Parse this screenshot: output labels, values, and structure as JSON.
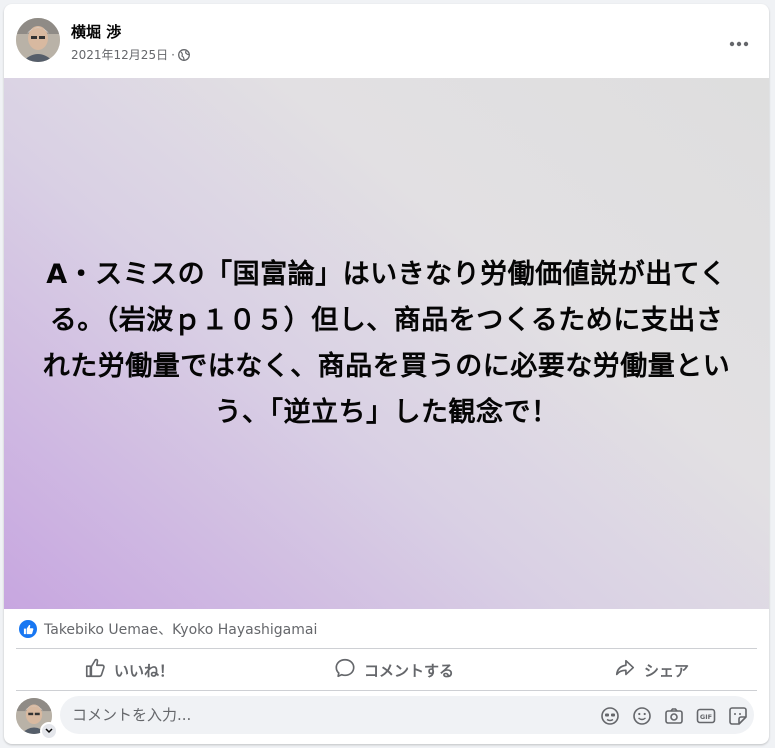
{
  "post": {
    "author": "横堀 渉",
    "date": "2021年12月25日",
    "separator": "·",
    "privacy_icon": "globe-icon",
    "more_icon": "more-options-icon",
    "banner_text": "A・スミスの「国富論」はいきなり労働価値説が出てくる。（岩波ｐ１０５）但し、商品をつくるために支出された労働量ではなく、商品を買うのに必要な労働量という、「逆立ち」した観念で！",
    "banner_colors": {
      "start": "#c7a6e0",
      "end": "#dedede"
    }
  },
  "reactions": {
    "icon": "like-badge-icon",
    "names": "Takebiko Uemae、Kyoko Hayashigamai"
  },
  "actions": {
    "like_label": "いいね！",
    "comment_label": "コメントする",
    "share_label": "シェア"
  },
  "comment_box": {
    "placeholder": "コメントを入力...",
    "icons": [
      "avatar-sticker-icon",
      "emoji-icon",
      "camera-icon",
      "gif-icon",
      "sticker-icon"
    ]
  },
  "colors": {
    "accent": "#1877f2",
    "secondary_text": "#65676b"
  }
}
